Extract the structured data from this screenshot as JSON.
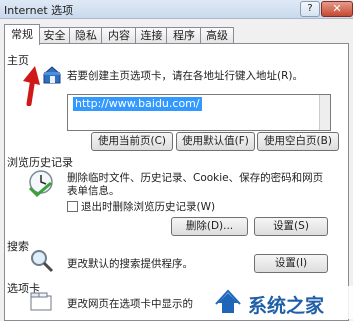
{
  "window": {
    "title": "Internet 选项",
    "help_label": "?",
    "close_label": "✕"
  },
  "tabs": [
    {
      "label": "常规",
      "active": true
    },
    {
      "label": "安全"
    },
    {
      "label": "隐私"
    },
    {
      "label": "内容"
    },
    {
      "label": "连接"
    },
    {
      "label": "程序"
    },
    {
      "label": "高级"
    }
  ],
  "home": {
    "section_label": "主页",
    "instruction": "若要创建主页选项卡，请在各地址行键入地址(R)。",
    "url_value": "http://www.baidu.com/",
    "use_current": "使用当前页(C)",
    "use_default": "使用默认值(F)",
    "use_blank": "使用空白页(B)"
  },
  "history": {
    "section_label": "浏览历史记录",
    "desc_line1": "删除临时文件、历史记录、Cookie、保存的密码和网页",
    "desc_line2": "表单信息。",
    "checkbox_label": "退出时删除浏览历史记录(W)",
    "delete_button": "删除(D)...",
    "settings_button": "设置(S)"
  },
  "search": {
    "section_label": "搜索",
    "desc": "更改默认的搜索提供程序。",
    "settings_button": "设置(I)"
  },
  "tabs_section": {
    "section_label": "选项卡",
    "desc": "更改网页在选项卡中显示的"
  },
  "watermark": {
    "text": "系统之家"
  },
  "colors": {
    "arrow": "#d01818",
    "selection": "#3399ff"
  }
}
